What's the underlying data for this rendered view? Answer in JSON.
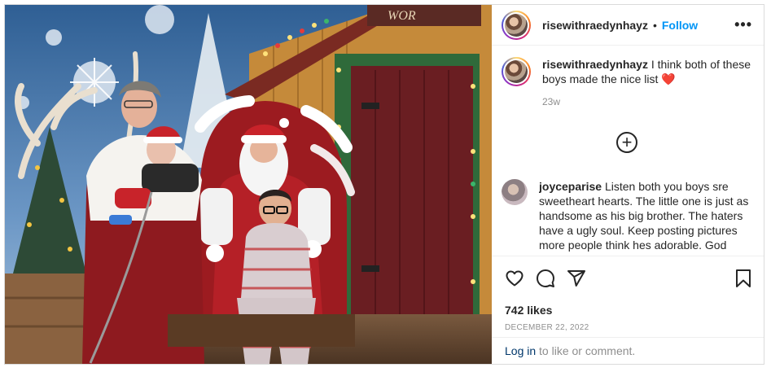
{
  "header": {
    "username": "risewithraedynhayz",
    "separator": "•",
    "follow_label": "Follow",
    "more_label": "•••"
  },
  "caption": {
    "username": "risewithraedynhayz",
    "text": "I think both of these boys made the nice list ❤️",
    "time": "23w"
  },
  "load_more_label": "+",
  "comments": [
    {
      "username": "joyceparise",
      "text": "Listen both you boys sre sweetheart hearts. The little one is just as handsome as his big brother. The haters have a ugly soul. Keep posting pictures more people think hes adorable. God bless you all."
    }
  ],
  "likes": "742 likes",
  "date": "DECEMBER 22, 2022",
  "login": {
    "link": "Log in",
    "rest": "to like or comment."
  },
  "photo": {
    "sign_text": "WOR"
  },
  "colors": {
    "accent": "#0095f6",
    "link": "#00376b",
    "muted": "#8e8e8e",
    "heart": "#ed4956"
  },
  "icons": [
    "heart-icon",
    "comment-icon",
    "share-icon",
    "bookmark-icon",
    "more-icon",
    "plus-circle-icon"
  ]
}
